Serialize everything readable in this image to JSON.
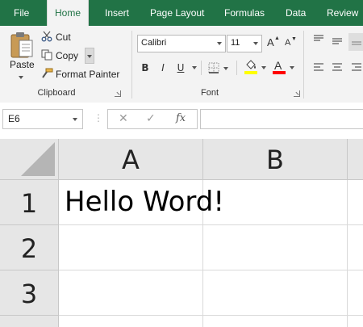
{
  "ribbon_tabs": [
    {
      "label": "File",
      "active": false
    },
    {
      "label": "Home",
      "active": true
    },
    {
      "label": "Insert",
      "active": false
    },
    {
      "label": "Page Layout",
      "active": false
    },
    {
      "label": "Formulas",
      "active": false
    },
    {
      "label": "Data",
      "active": false
    },
    {
      "label": "Review",
      "active": false
    }
  ],
  "clipboard": {
    "paste_label": "Paste",
    "cut_label": "Cut",
    "copy_label": "Copy",
    "format_painter_label": "Format Painter",
    "group_label": "Clipboard"
  },
  "font": {
    "font_name": "Calibri",
    "font_size": "11",
    "bold": "B",
    "italic": "I",
    "underline": "U",
    "grow": "A",
    "shrink": "A",
    "font_color_glyph": "A",
    "group_label": "Font"
  },
  "formula_bar": {
    "name_box": "E6",
    "cancel_glyph": "✕",
    "enter_glyph": "✓",
    "fx_label": "fx",
    "formula_value": ""
  },
  "grid": {
    "columns": [
      "A",
      "B"
    ],
    "rows": [
      "1",
      "2",
      "3"
    ],
    "cells": {
      "A1": "Hello Word!"
    }
  },
  "colors": {
    "accent": "#217346",
    "highlight": "#ffff00",
    "font_color": "#ff0000"
  }
}
